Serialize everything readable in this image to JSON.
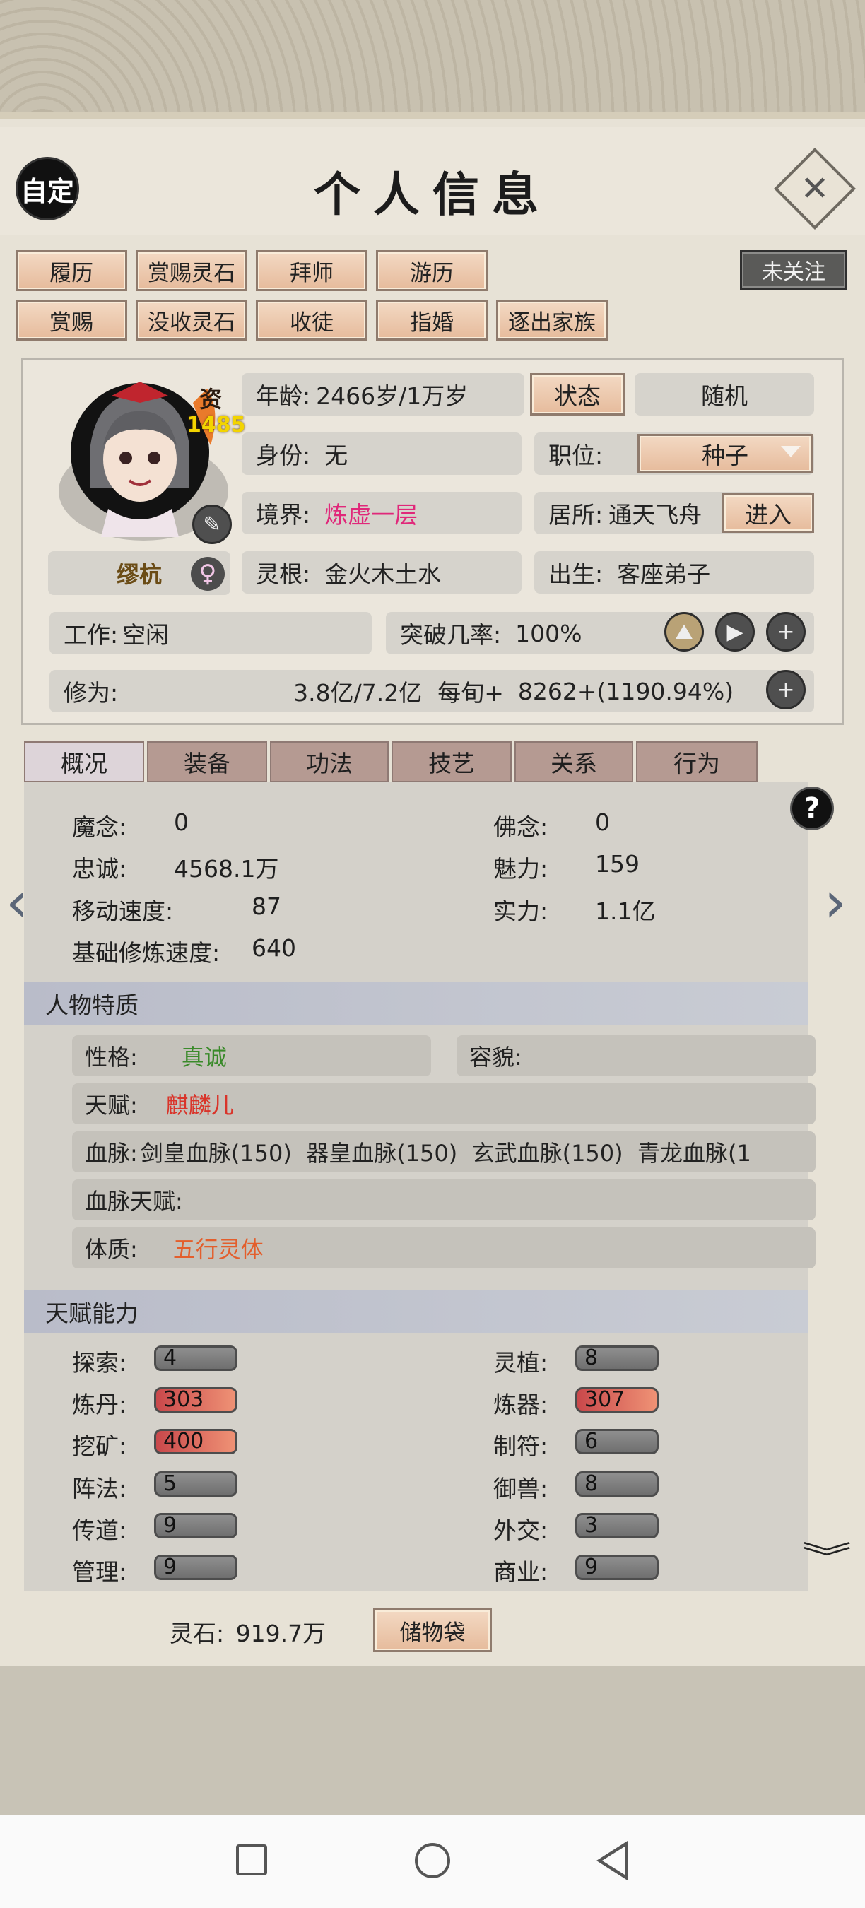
{
  "header": {
    "title": "个人信息",
    "auto_label": "自定",
    "follow_label": "未关注"
  },
  "actions_row1": [
    "履历",
    "赏赐灵石",
    "拜师",
    "游历"
  ],
  "actions_row2": [
    "赏赐",
    "没收灵石",
    "收徒",
    "指婚",
    "逐出家族"
  ],
  "character": {
    "aptitude_label": "资",
    "aptitude_value": "1485",
    "name": "缪杭",
    "gender_icon": "♀",
    "age_label": "年龄:",
    "age_value": "2466岁/1万岁",
    "status_btn": "状态",
    "random_btn": "随机",
    "identity_label": "身份:",
    "identity_value": "无",
    "position_label": "职位:",
    "position_value": "种子",
    "realm_label": "境界:",
    "realm_value": "炼虚一层",
    "residence_label": "居所:",
    "residence_value": "通天飞舟",
    "enter_btn": "进入",
    "root_label": "灵根:",
    "root_value": "金火木土水",
    "origin_label": "出生:",
    "origin_value": "客座弟子",
    "work_label": "工作:",
    "work_value": "空闲",
    "breakthrough_label": "突破几率:",
    "breakthrough_value": "100%",
    "cultivation_label": "修为:",
    "cultivation_value": "3.8亿/7.2亿",
    "per_turn_label": "每旬+",
    "per_turn_value": "8262+(1190.94%)"
  },
  "tabs": [
    "概况",
    "装备",
    "功法",
    "技艺",
    "关系",
    "行为"
  ],
  "stats": [
    {
      "label": "魔念:",
      "value": "0"
    },
    {
      "label": "佛念:",
      "value": "0"
    },
    {
      "label": "忠诚:",
      "value": "4568.1万"
    },
    {
      "label": "魅力:",
      "value": "159"
    },
    {
      "label": "移动速度:",
      "value": "87"
    },
    {
      "label": "实力:",
      "value": "1.1亿"
    },
    {
      "label": "基础修炼速度:",
      "value": "640"
    }
  ],
  "traits": {
    "section_title": "人物特质",
    "personality_label": "性格:",
    "personality_value": "真诚",
    "looks_label": "容貌:",
    "talent_label": "天赋:",
    "talent_value": "麒麟儿",
    "bloodline_label": "血脉:",
    "bloodline_value": "剑皇血脉(150)  器皇血脉(150)  玄武血脉(150)  青龙血脉(1",
    "bloodline_talent_label": "血脉天赋:",
    "physique_label": "体质:",
    "physique_value": "五行灵体"
  },
  "abilities": {
    "section_title": "天赋能力",
    "items": [
      {
        "label": "探索:",
        "value": "4",
        "hot": false
      },
      {
        "label": "灵植:",
        "value": "8",
        "hot": false
      },
      {
        "label": "炼丹:",
        "value": "303",
        "hot": true
      },
      {
        "label": "炼器:",
        "value": "307",
        "hot": true
      },
      {
        "label": "挖矿:",
        "value": "400",
        "hot": true
      },
      {
        "label": "制符:",
        "value": "6",
        "hot": false
      },
      {
        "label": "阵法:",
        "value": "5",
        "hot": false
      },
      {
        "label": "御兽:",
        "value": "8",
        "hot": false
      },
      {
        "label": "传道:",
        "value": "9",
        "hot": false
      },
      {
        "label": "外交:",
        "value": "3",
        "hot": false
      },
      {
        "label": "管理:",
        "value": "9",
        "hot": false
      },
      {
        "label": "商业:",
        "value": "9",
        "hot": false
      }
    ]
  },
  "footer": {
    "stones_label": "灵石:",
    "stones_value": "919.7万",
    "storage_btn": "储物袋"
  },
  "icons": {
    "help": "?",
    "close": "✕",
    "prev": "‹",
    "next": "›",
    "more": "︾"
  }
}
